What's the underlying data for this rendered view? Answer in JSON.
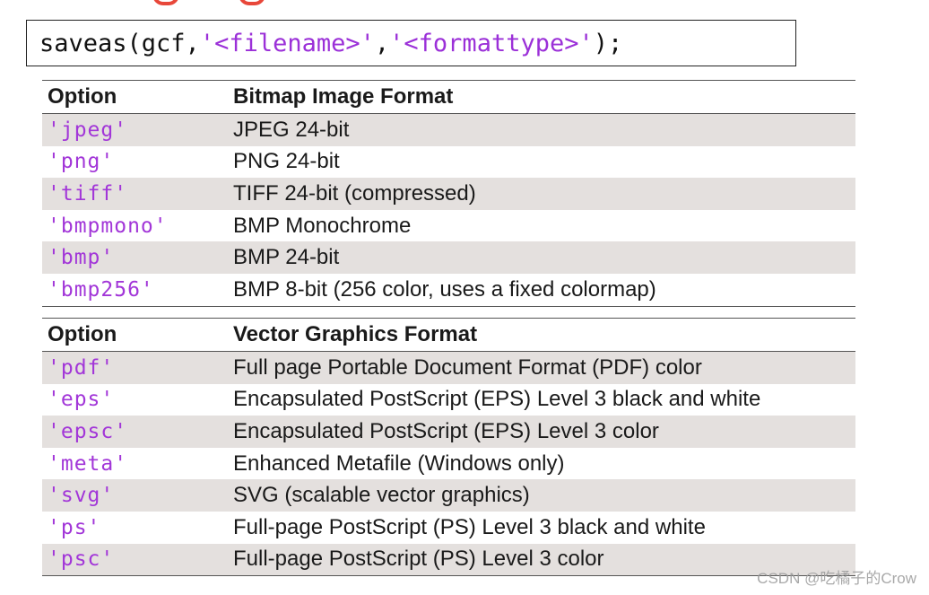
{
  "code": {
    "prefix": "saveas(gcf,",
    "arg1": "'<filename>'",
    "comma": ",",
    "arg2": "'<formattype>'",
    "suffix": ");"
  },
  "bitmap_table": {
    "header_option": "Option",
    "header_format": "Bitmap Image Format",
    "rows": [
      {
        "option": "'jpeg'",
        "format": "JPEG 24-bit"
      },
      {
        "option": "'png'",
        "format": "PNG 24-bit"
      },
      {
        "option": "'tiff'",
        "format": "TIFF 24-bit (compressed)"
      },
      {
        "option": "'bmpmono'",
        "format": "BMP Monochrome"
      },
      {
        "option": "'bmp'",
        "format": "BMP 24-bit"
      },
      {
        "option": "'bmp256'",
        "format": "BMP 8-bit (256 color, uses a fixed colormap)"
      }
    ]
  },
  "vector_table": {
    "header_option": "Option",
    "header_format": "Vector Graphics Format",
    "rows": [
      {
        "option": "'pdf'",
        "format": "Full page Portable Document Format (PDF) color"
      },
      {
        "option": "'eps'",
        "format": "Encapsulated PostScript (EPS) Level 3 black and white"
      },
      {
        "option": "'epsc'",
        "format": "Encapsulated PostScript (EPS) Level 3 color"
      },
      {
        "option": "'meta'",
        "format": "Enhanced Metafile (Windows only)"
      },
      {
        "option": "'svg'",
        "format": "SVG (scalable vector graphics)"
      },
      {
        "option": "'ps'",
        "format": "Full-page PostScript (PS) Level 3 black and white"
      },
      {
        "option": "'psc'",
        "format": "Full-page PostScript (PS) Level 3 color"
      }
    ]
  },
  "watermark": "CSDN @吃橘子的Crow",
  "colors": {
    "option_text": "#a236d8",
    "row_shade": "#e4e0de",
    "accent_red": "#e8473a"
  }
}
